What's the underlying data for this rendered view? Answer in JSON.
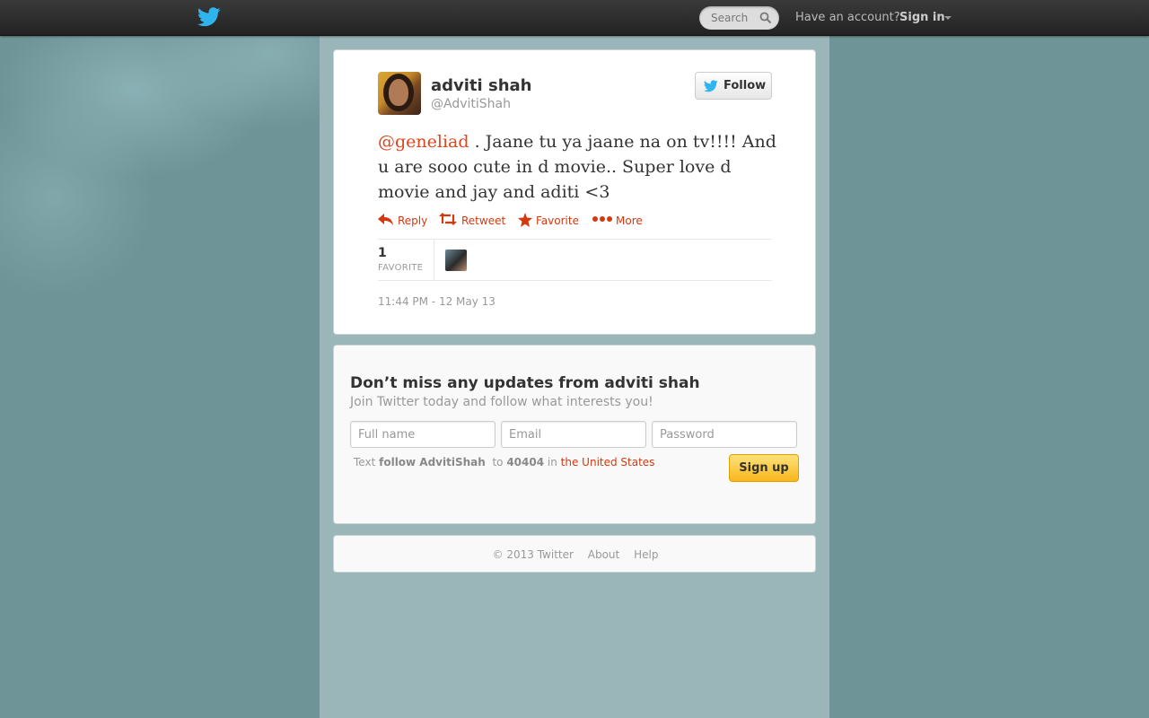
{
  "topbar": {
    "search_placeholder": "Search",
    "have_account": "Have an account?",
    "sign_in": "Sign in"
  },
  "tweet": {
    "display_name": "adviti shah",
    "screen_name": "@AdvitiShah",
    "follow_label": "Follow",
    "mention": "@geneliad",
    "text": " . Jaane tu ya jaane na on tv!!!! And u are sooo cute in d movie.. Super love d movie and jay and aditi <3",
    "actions": {
      "reply": "Reply",
      "retweet": "Retweet",
      "favorite": "Favorite",
      "more": "More"
    },
    "favorite_count": "1",
    "favorite_label": "FAVORITE",
    "timestamp": "11:44 PM - 12 May 13"
  },
  "signup": {
    "title": "Don’t miss any updates from adviti shah",
    "subtitle": "Join Twitter today and follow what interests you!",
    "full_name_placeholder": "Full name",
    "email_placeholder": "Email",
    "password_placeholder": "Password",
    "sms_text": "Text",
    "sms_command": "follow AdvitiShah",
    "sms_to": "to",
    "sms_number": "40404",
    "sms_in": "in",
    "sms_country": "the United States",
    "button": "Sign up"
  },
  "footer": {
    "copyright": "© 2013 Twitter",
    "about": "About",
    "help": "Help"
  },
  "colors": {
    "accent": "#d6380e",
    "background": "#6f9497"
  }
}
